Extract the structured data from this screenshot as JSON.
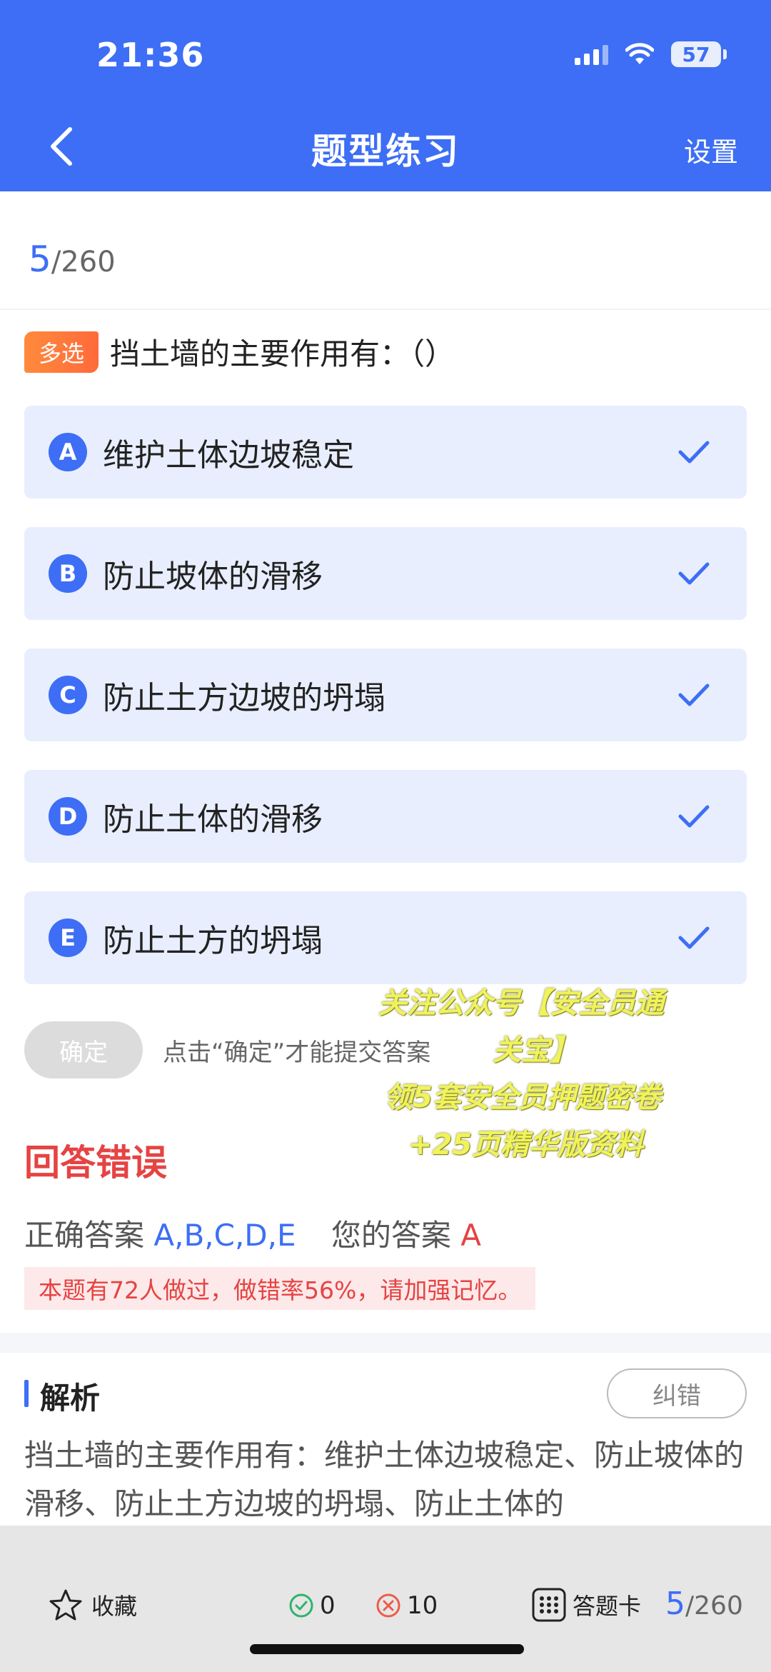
{
  "status_bar": {
    "time": "21:36",
    "battery": "57"
  },
  "header": {
    "title": "题型练习",
    "settings_label": "设置"
  },
  "progress": {
    "current": "5",
    "total": "/260"
  },
  "question": {
    "type_tag": "多选",
    "text": "挡土墙的主要作用有：（）"
  },
  "options": [
    {
      "letter": "A",
      "text": "维护土体边坡稳定",
      "selected": true
    },
    {
      "letter": "B",
      "text": "防止坡体的滑移",
      "selected": true
    },
    {
      "letter": "C",
      "text": "防止土方边坡的坍塌",
      "selected": true
    },
    {
      "letter": "D",
      "text": "防止土体的滑移",
      "selected": true
    },
    {
      "letter": "E",
      "text": "防止土方的坍塌",
      "selected": true
    }
  ],
  "confirm": {
    "label": "确定",
    "hint": "点击“确定”才能提交答案"
  },
  "overlay": {
    "line1": "关注公众号【安全员通",
    "line2": "关宝】",
    "line3": "领5套安全员押题密卷",
    "line4": "+25页精华版资料"
  },
  "result": {
    "title": "回答错误",
    "correct_label": "正确答案",
    "correct_value": "A,B,C,D,E",
    "yours_label": "您的答案",
    "yours_value": "A",
    "stat_text": "本题有72人做过，做错率56%，请加强记忆。"
  },
  "analysis": {
    "title": "解析",
    "report_label": "纠错",
    "text": "挡土墙的主要作用有：维护土体边坡稳定、防止坡体的滑移、防止土方边坡的坍塌、防止土体的"
  },
  "bottom_bar": {
    "favorite_label": "收藏",
    "correct_count": "0",
    "wrong_count": "10",
    "answer_card_label": "答题卡",
    "progress_current": "5",
    "progress_total": "/260"
  },
  "colors": {
    "primary": "#3d6ef5",
    "error": "#e64343",
    "tag": "#ff7a3a",
    "option_bg": "#e8eefd"
  }
}
